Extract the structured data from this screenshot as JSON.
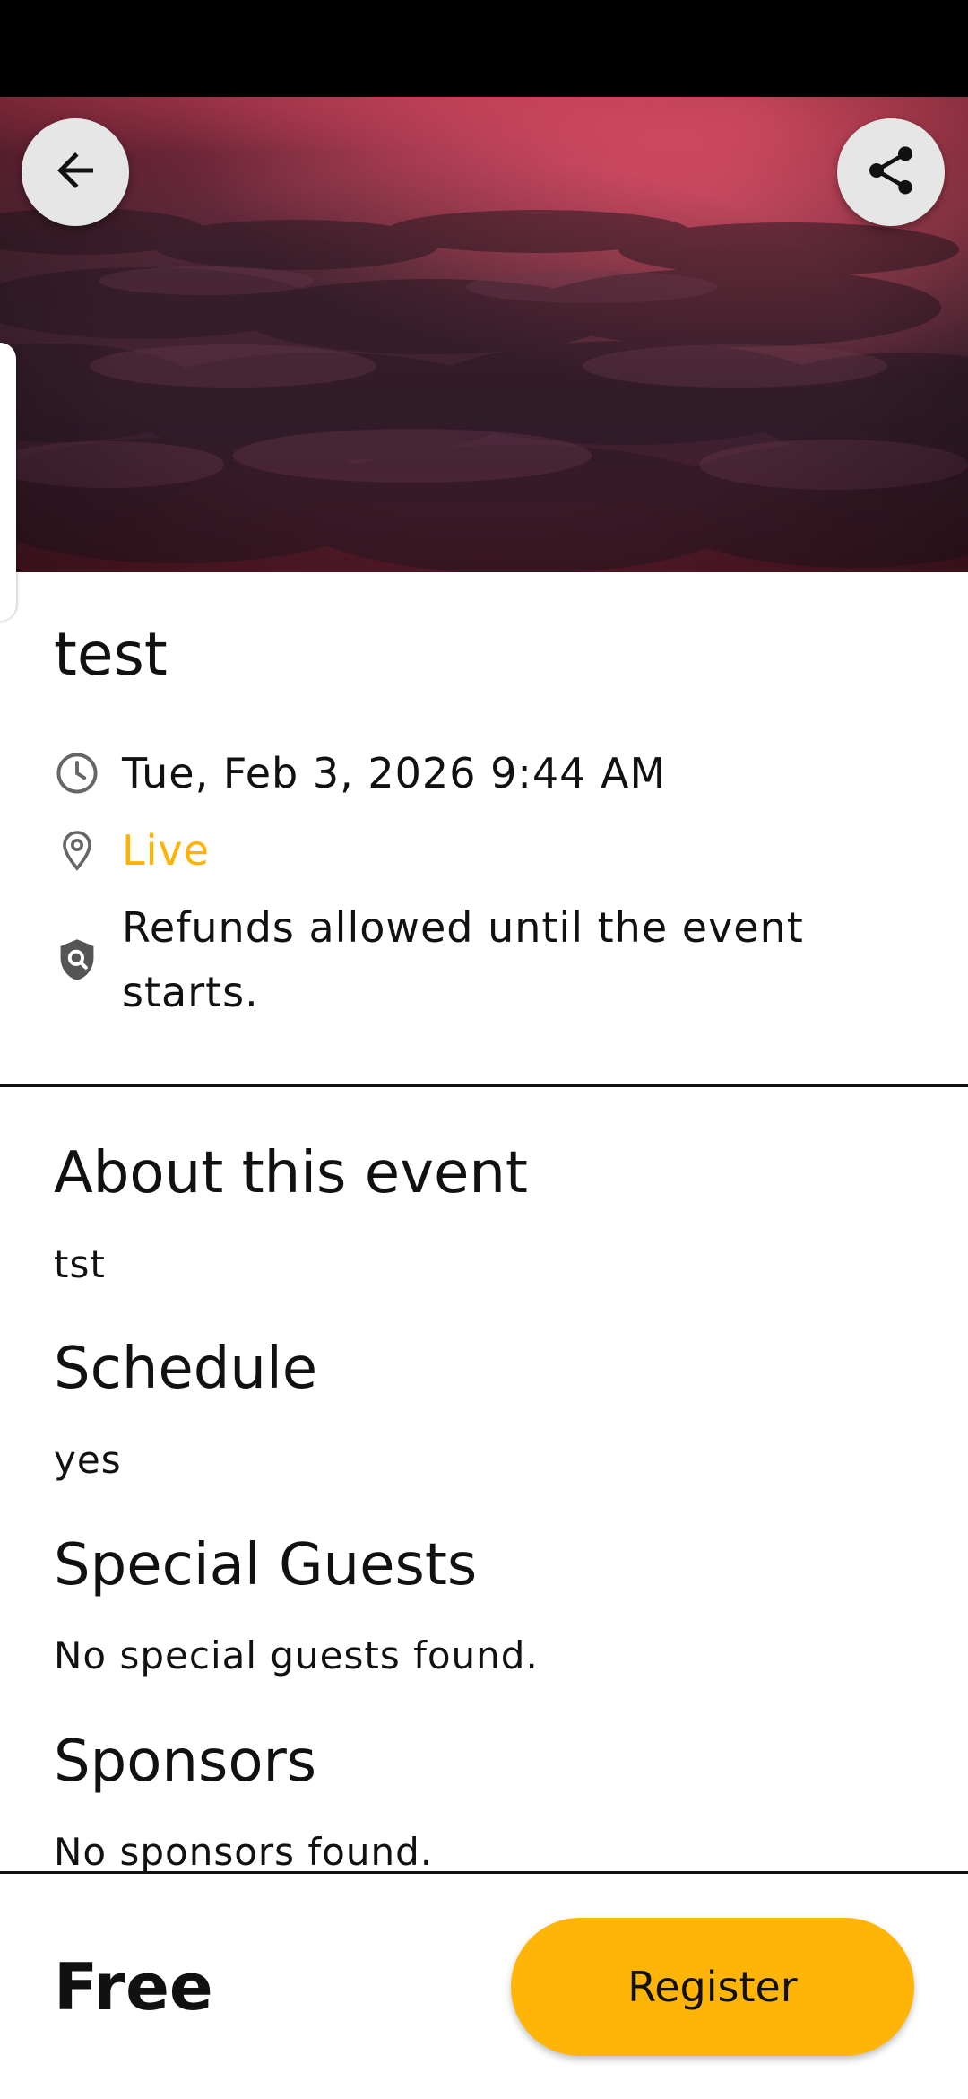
{
  "event": {
    "title": "test",
    "date_time": "Tue, Feb 3, 2026 9:44 AM",
    "location": "Live",
    "refund_policy": "Refunds allowed until the event starts."
  },
  "sections": {
    "about": {
      "heading": "About this event",
      "body": "tst"
    },
    "schedule": {
      "heading": "Schedule",
      "body": "yes"
    },
    "guests": {
      "heading": "Special Guests",
      "body": "No special guests found."
    },
    "sponsors": {
      "heading": "Sponsors",
      "body": "No sponsors found."
    }
  },
  "footer": {
    "price": "Free",
    "register_label": "Register"
  },
  "icons": {
    "back": "arrow-back-icon",
    "share": "share-icon",
    "date": "clock-icon",
    "location": "location-pin-icon",
    "refund": "shield-search-icon"
  },
  "colors": {
    "accent": "#ffb508",
    "location_text": "#ffb300",
    "text": "#111111"
  }
}
